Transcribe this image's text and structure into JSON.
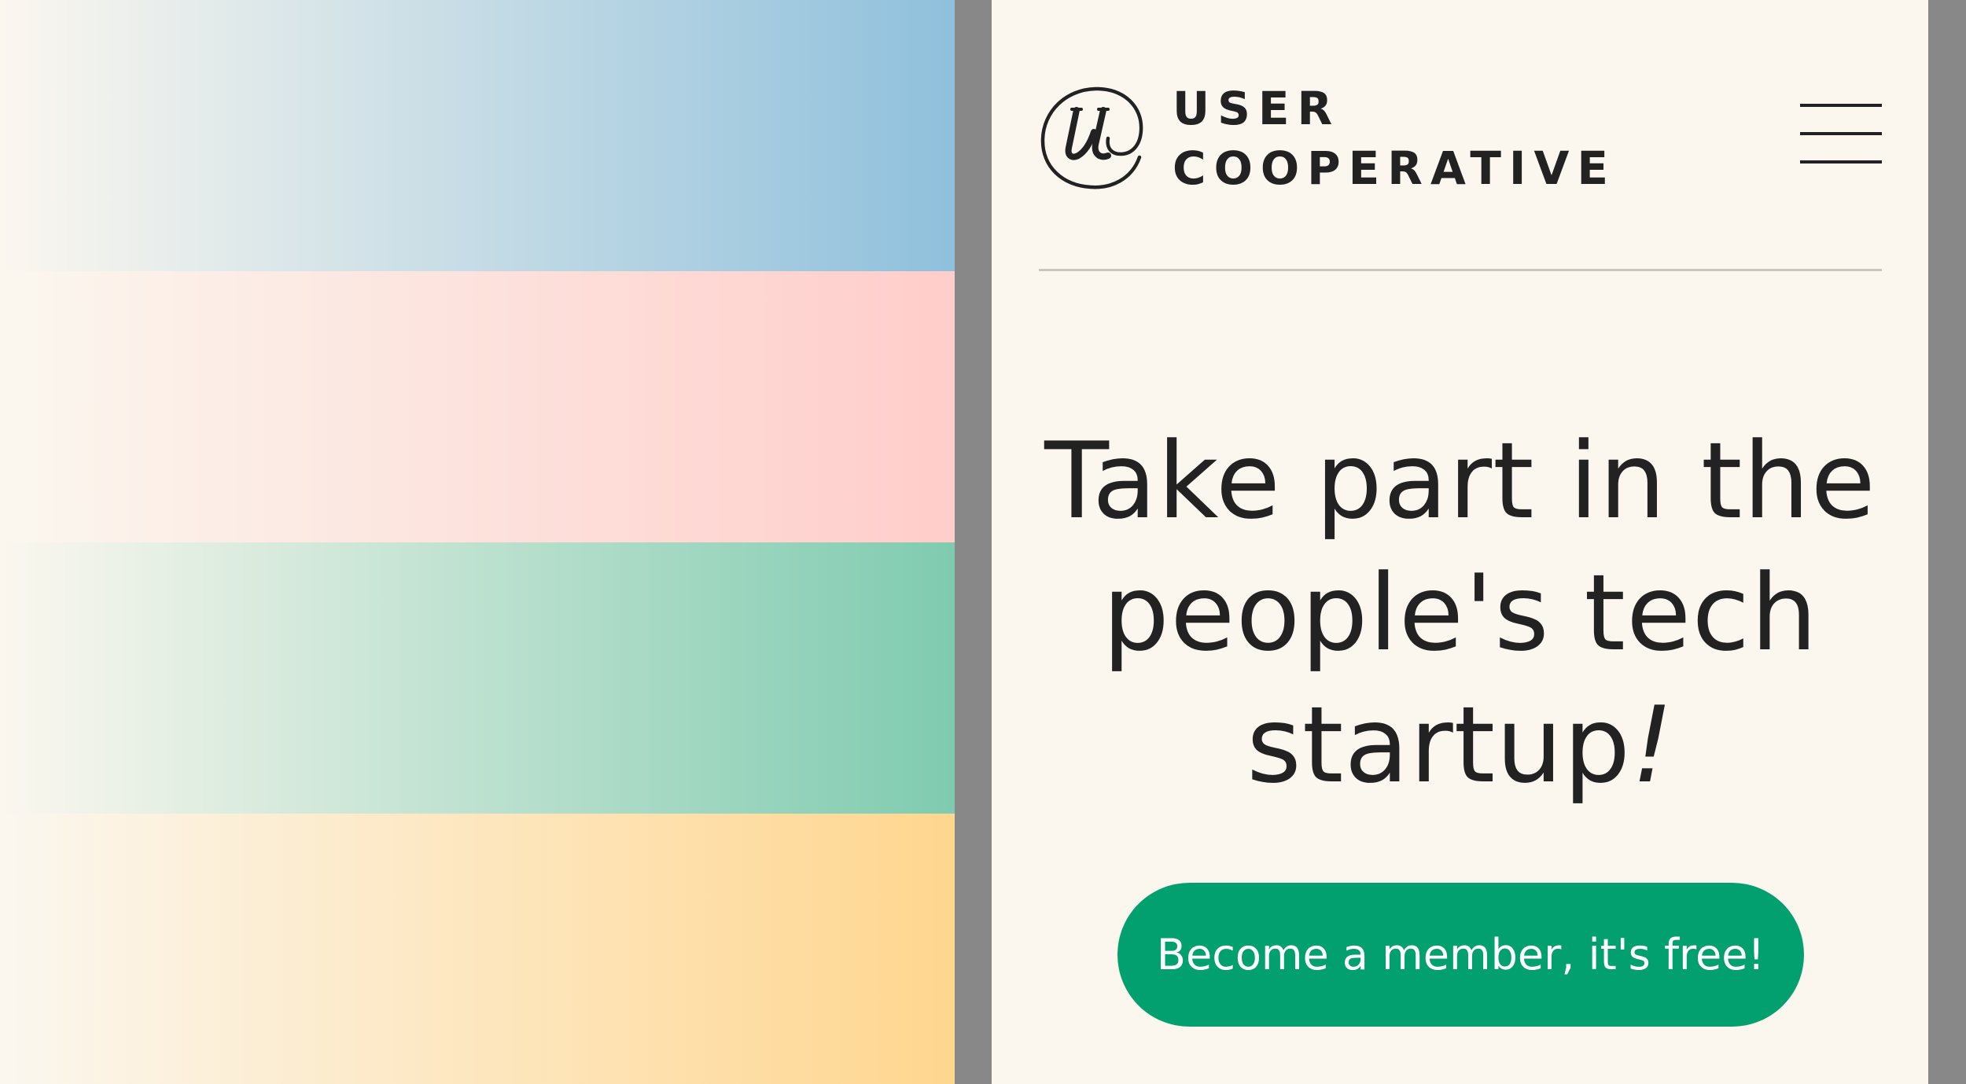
{
  "colors": {
    "background": "#fbf7ef",
    "frame": "#888888",
    "text": "#222222",
    "divider": "#c9c4bc",
    "accent": "#03a06f",
    "band_blue": "#8fc0dc",
    "band_pink": "#ffcdca",
    "band_green": "#7fcbb0",
    "band_yellow": "#ffd68f"
  },
  "header": {
    "logo_icon": "at-sign-u-logo-icon",
    "logo_line1": "USER",
    "logo_line2": "COOPERATIVE",
    "menu_icon": "hamburger-menu-icon"
  },
  "hero": {
    "headline_line1": "Take part in the",
    "headline_line2": "people's tech",
    "headline_line3_main": "startup",
    "headline_line3_mark": "!",
    "cta_label": "Become a member, it's free!"
  }
}
